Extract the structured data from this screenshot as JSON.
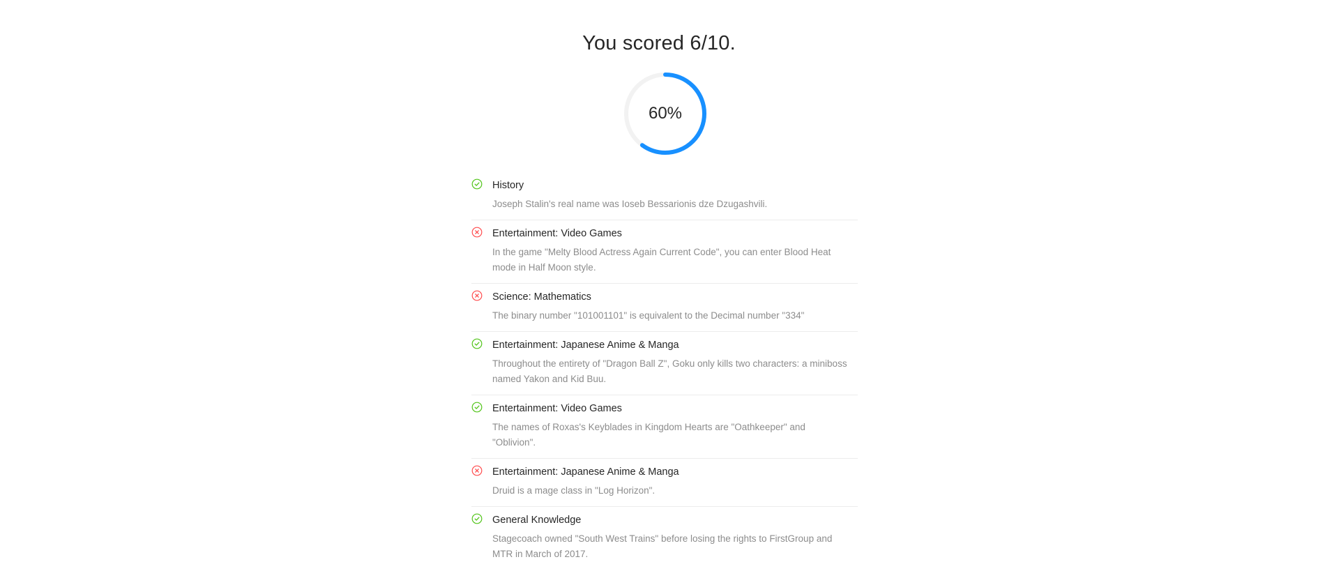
{
  "score_title": "You scored 6/10.",
  "progress": {
    "percent": 60,
    "label": "60%",
    "stroke_color": "#1890ff",
    "trail_color": "#f2f2f2"
  },
  "colors": {
    "correct": "#52c41a",
    "incorrect": "#ff4d4f"
  },
  "results": [
    {
      "status": "correct",
      "icon": "check-circle-icon",
      "category": "History",
      "question": "Joseph Stalin's real name was Ioseb Bessarionis dze Dzugashvili."
    },
    {
      "status": "incorrect",
      "icon": "close-circle-icon",
      "category": "Entertainment: Video Games",
      "question": "In the game \"Melty Blood Actress Again Current Code\", you can enter Blood Heat mode in Half Moon style."
    },
    {
      "status": "incorrect",
      "icon": "close-circle-icon",
      "category": "Science: Mathematics",
      "question": "The binary number \"101001101\" is equivalent to the Decimal number \"334\""
    },
    {
      "status": "correct",
      "icon": "check-circle-icon",
      "category": "Entertainment: Japanese Anime & Manga",
      "question": "Throughout the entirety of \"Dragon Ball Z\", Goku only kills two characters: a miniboss named Yakon and Kid Buu."
    },
    {
      "status": "correct",
      "icon": "check-circle-icon",
      "category": "Entertainment: Video Games",
      "question": "The names of Roxas's Keyblades in Kingdom Hearts are \"Oathkeeper\" and \"Oblivion\"."
    },
    {
      "status": "incorrect",
      "icon": "close-circle-icon",
      "category": "Entertainment: Japanese Anime & Manga",
      "question": "Druid is a mage class in \"Log Horizon\"."
    },
    {
      "status": "correct",
      "icon": "check-circle-icon",
      "category": "General Knowledge",
      "question": "Stagecoach owned \"South West Trains\" before losing the rights to FirstGroup and MTR in March of 2017."
    }
  ]
}
